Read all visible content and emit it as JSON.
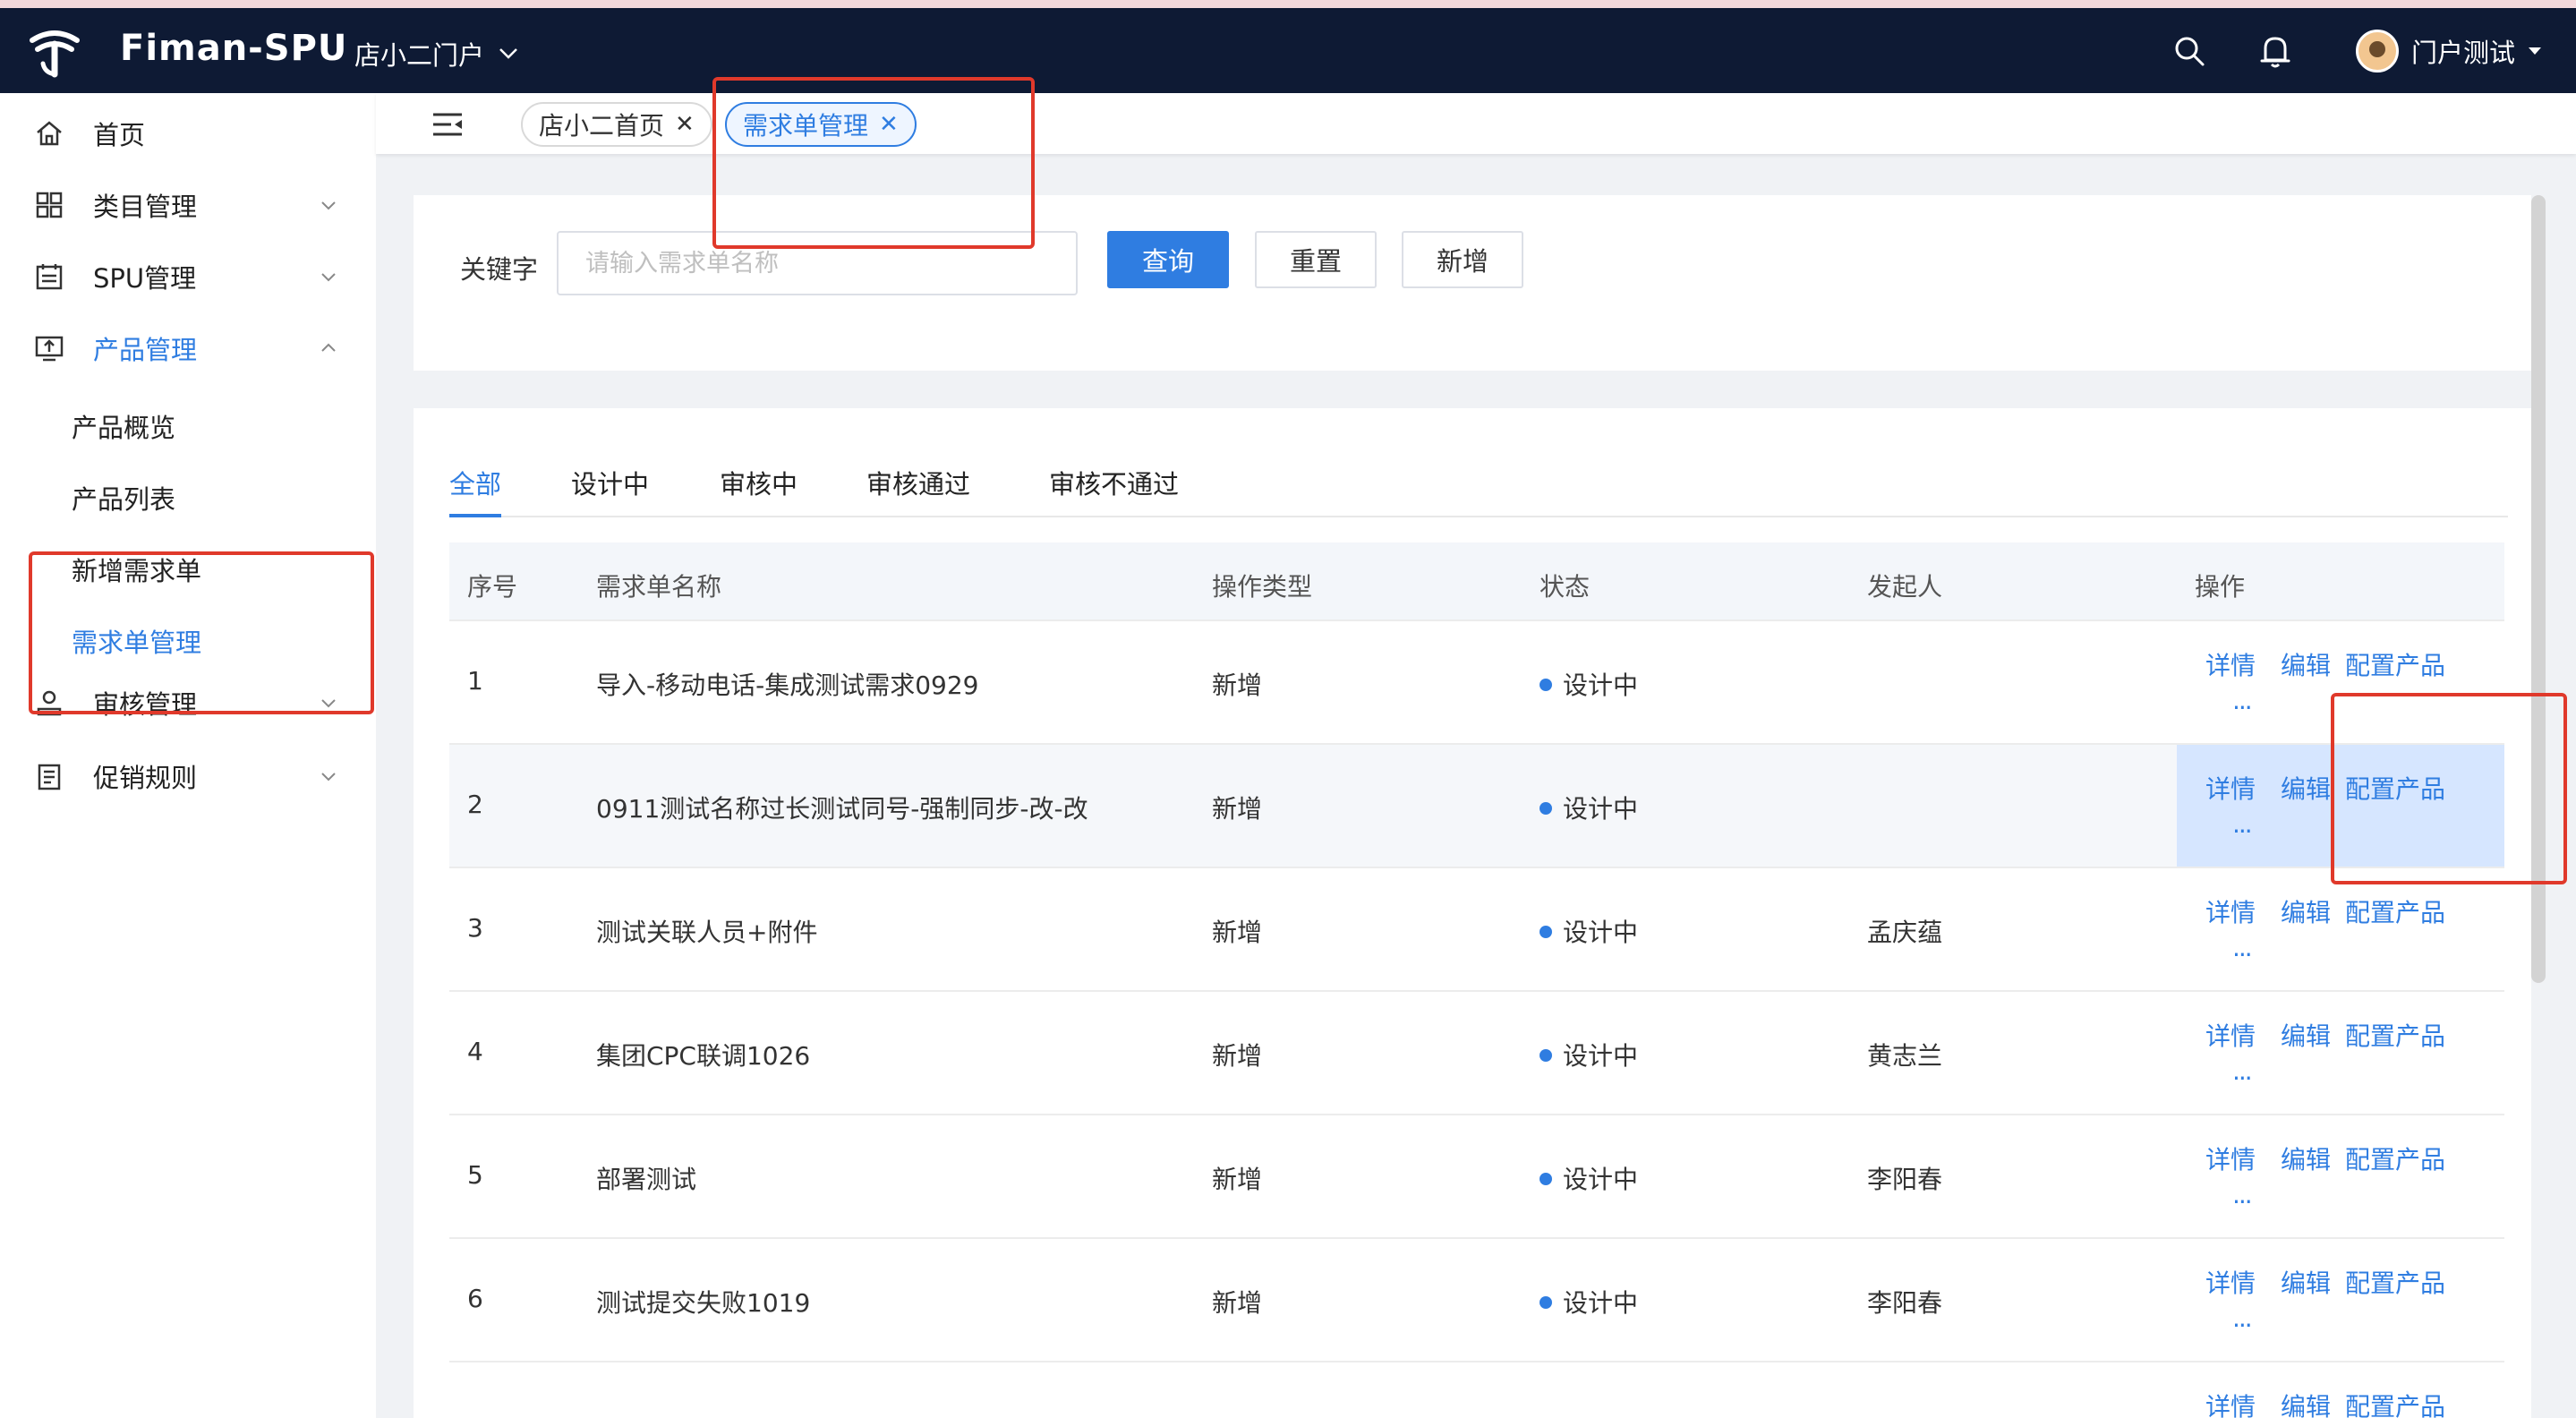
{
  "navbar": {
    "app_title": "Fiman-SPU",
    "portal_label": "店小二门户",
    "user_name": "门户测试"
  },
  "sidebar": {
    "menu": [
      {
        "label": "首页",
        "icon": "home-icon"
      },
      {
        "label": "类目管理",
        "icon": "grid-icon"
      },
      {
        "label": "SPU管理",
        "icon": "calendar-list-icon"
      },
      {
        "label": "产品管理",
        "icon": "monitor-upload-icon"
      }
    ],
    "product_sub": [
      "产品概览",
      "产品列表",
      "新增需求单",
      "需求单管理"
    ],
    "audit_label": "审核管理",
    "promo_label": "促销规则"
  },
  "tabs": [
    {
      "label": "店小二首页"
    },
    {
      "label": "需求单管理"
    }
  ],
  "search": {
    "keyword_label": "关键字",
    "placeholder": "请输入需求单名称",
    "query_label": "查询",
    "reset_label": "重置",
    "add_label": "新增"
  },
  "status_tabs": [
    "全部",
    "设计中",
    "审核中",
    "审核通过",
    "审核不通过"
  ],
  "table": {
    "headers": [
      "序号",
      "需求单名称",
      "操作类型",
      "状态",
      "发起人",
      "操作"
    ],
    "actions": {
      "detail": "详情",
      "edit": "编辑",
      "config": "配置产品",
      "more": "..."
    },
    "rows": [
      {
        "no": "1",
        "name": "导入-移动电话-集成测试需求0929",
        "op_type": "新增",
        "status": "设计中",
        "initiator": ""
      },
      {
        "no": "2",
        "name": "0911测试名称过长测试同号-强制同步-改-改",
        "op_type": "新增",
        "status": "设计中",
        "initiator": ""
      },
      {
        "no": "3",
        "name": "测试关联人员+附件",
        "op_type": "新增",
        "status": "设计中",
        "initiator": "孟庆蕴"
      },
      {
        "no": "4",
        "name": "集团CPC联调1026",
        "op_type": "新增",
        "status": "设计中",
        "initiator": "黄志兰"
      },
      {
        "no": "5",
        "name": "部署测试",
        "op_type": "新增",
        "status": "设计中",
        "initiator": "李阳春"
      },
      {
        "no": "6",
        "name": "测试提交失败1019",
        "op_type": "新增",
        "status": "设计中",
        "initiator": "李阳春"
      }
    ]
  },
  "colors": {
    "navbar_bg": "#0e1a34",
    "accent": "#2f7de1",
    "annotation": "#e0392b"
  }
}
